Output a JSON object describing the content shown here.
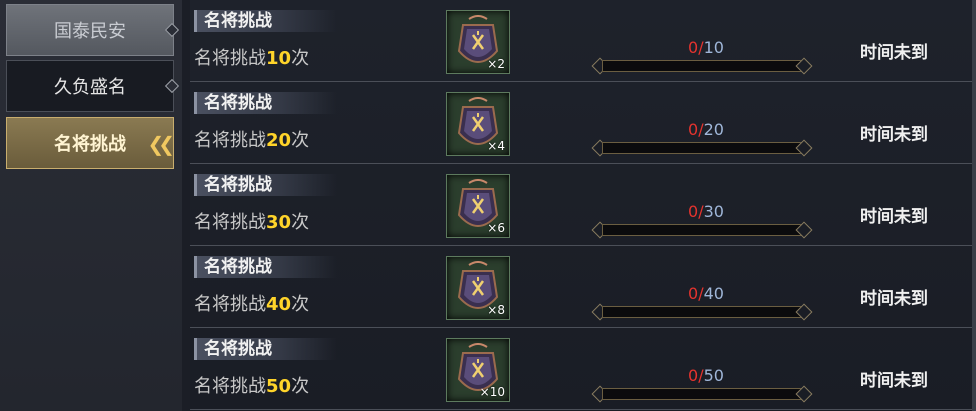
{
  "sidebar": {
    "tabs": [
      {
        "label": "国泰民安"
      },
      {
        "label": "久负盛名"
      },
      {
        "label": "名将挑战",
        "active": true
      }
    ]
  },
  "colors": {
    "accent": "#ffd42a",
    "progress_current": "#e4332e",
    "progress_max": "#9fb6d8",
    "active_tab": "#8a7a52"
  },
  "tasks": [
    {
      "title": "名将挑战",
      "desc_prefix": "名将挑战",
      "desc_num": "10",
      "desc_suffix": "次",
      "reward_icon": "token-medal-icon",
      "reward_qty": "×2",
      "progress_cur": "0",
      "progress_sep": "/",
      "progress_max": "10",
      "progress_fraction": 0,
      "status": "时间未到"
    },
    {
      "title": "名将挑战",
      "desc_prefix": "名将挑战",
      "desc_num": "20",
      "desc_suffix": "次",
      "reward_icon": "token-medal-icon",
      "reward_qty": "×4",
      "progress_cur": "0",
      "progress_sep": "/",
      "progress_max": "20",
      "progress_fraction": 0,
      "status": "时间未到"
    },
    {
      "title": "名将挑战",
      "desc_prefix": "名将挑战",
      "desc_num": "30",
      "desc_suffix": "次",
      "reward_icon": "token-medal-icon",
      "reward_qty": "×6",
      "progress_cur": "0",
      "progress_sep": "/",
      "progress_max": "30",
      "progress_fraction": 0,
      "status": "时间未到"
    },
    {
      "title": "名将挑战",
      "desc_prefix": "名将挑战",
      "desc_num": "40",
      "desc_suffix": "次",
      "reward_icon": "token-medal-icon",
      "reward_qty": "×8",
      "progress_cur": "0",
      "progress_sep": "/",
      "progress_max": "40",
      "progress_fraction": 0,
      "status": "时间未到"
    },
    {
      "title": "名将挑战",
      "desc_prefix": "名将挑战",
      "desc_num": "50",
      "desc_suffix": "次",
      "reward_icon": "token-medal-icon",
      "reward_qty": "×10",
      "progress_cur": "0",
      "progress_sep": "/",
      "progress_max": "50",
      "progress_fraction": 0,
      "status": "时间未到"
    }
  ]
}
